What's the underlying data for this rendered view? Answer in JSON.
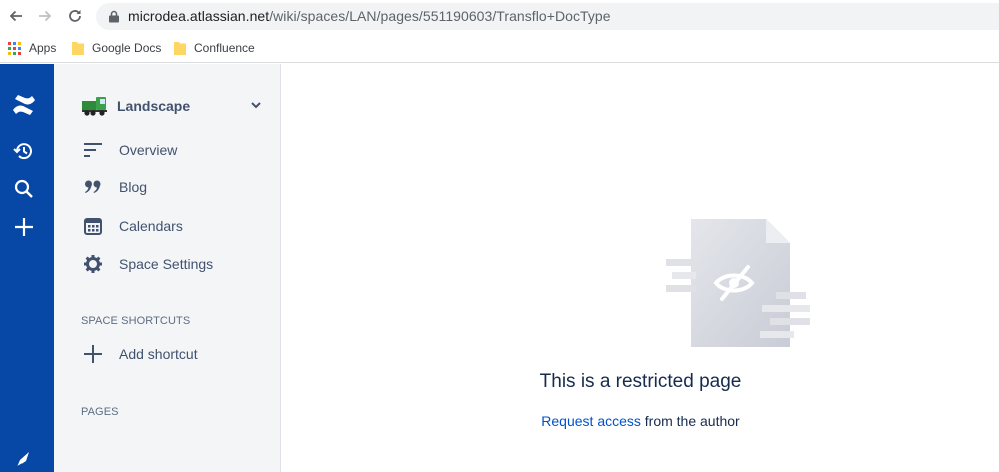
{
  "browser": {
    "url_host": "microdea.atlassian.net",
    "url_path": "/wiki/spaces/LAN/pages/551190603/Transflo+DocType",
    "bookmarks": [
      "Apps",
      "Google Docs",
      "Confluence"
    ]
  },
  "sidebar": {
    "space_name": "Landscape",
    "nav_items": [
      {
        "label": "Overview",
        "icon": "overview-icon"
      },
      {
        "label": "Blog",
        "icon": "quote-icon"
      },
      {
        "label": "Calendars",
        "icon": "calendar-icon"
      },
      {
        "label": "Space Settings",
        "icon": "gear-icon"
      }
    ],
    "shortcuts_heading": "SPACE SHORTCUTS",
    "add_shortcut": "Add shortcut",
    "pages_heading": "PAGES"
  },
  "main": {
    "title": "This is a restricted page",
    "request_link": "Request access",
    "request_suffix": " from the author"
  },
  "colors": {
    "rail": "#0747a6",
    "sidebar": "#f4f5f7",
    "link": "#0052cc",
    "text_dark": "#172b4d"
  }
}
